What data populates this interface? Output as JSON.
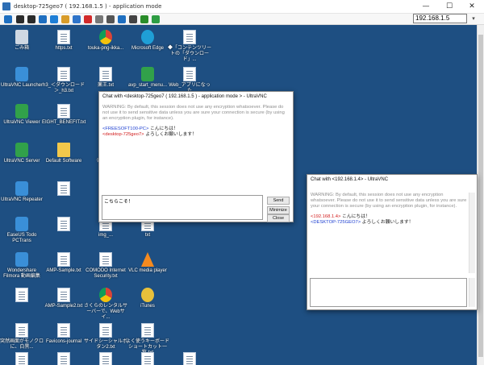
{
  "window": {
    "title": "desktop-725geo7 ( 192.168.1.5 ) - application mode",
    "minimize": "—",
    "maximize": "☐",
    "close": "✕"
  },
  "toolbar": {
    "ip_value": "192.168.1.5",
    "dropdown": "▾",
    "icons": [
      "send-ctrl-alt-del-icon",
      "refresh-icon",
      "settings-icon",
      "copy-icon",
      "windows-key-icon",
      "file-icon",
      "info-icon",
      "stop-icon",
      "chat-icon",
      "fullscreen-icon",
      "rect-icon",
      "close-connection-icon",
      "options-icon",
      "connection-icon"
    ],
    "icon_colors": [
      "#1f6fc0",
      "#2b2b2b",
      "#2b2b2b",
      "#1f6fc0",
      "#1f7fd6",
      "#d89c2a",
      "#2f74c9",
      "#d22a2a",
      "#777777",
      "#555555",
      "#1f6fc0",
      "#444444",
      "#2a8d2a",
      "#2f9e44"
    ]
  },
  "desktop": {
    "icons": [
      {
        "label": "ごみ箱",
        "glyph": "trash",
        "name": "recycle-bin-icon"
      },
      {
        "label": "https.txt",
        "glyph": "file",
        "name": "https-txt-icon"
      },
      {
        "label": "touka-png-ikka...",
        "glyph": "chrome",
        "name": "touka-png-icon"
      },
      {
        "label": "Microsoft Edge",
        "glyph": "edge",
        "name": "edge-icon"
      },
      {
        "label": "◆「コンテンツリートの「ダウンロード」...",
        "glyph": "file",
        "name": "content-download-icon"
      },
      {
        "label": "UltraVNC Launcher",
        "glyph": "app",
        "name": "ultravnc-launcher-icon"
      },
      {
        "label": "h3_＜ダウンロード＞_h3.txt",
        "glyph": "file",
        "name": "h3-download-icon"
      },
      {
        "label": "薬王.txt",
        "glyph": "file",
        "name": "yakuou-txt-icon"
      },
      {
        "label": "avp_start_menu...",
        "glyph": "green",
        "name": "avp-start-menu-icon"
      },
      {
        "label": "Web_アプリになった_Google_Earth.txt",
        "glyph": "file",
        "name": "web-app-google-earth-icon"
      },
      {
        "label": "UltraVNC Viewer",
        "glyph": "green",
        "name": "ultravnc-viewer-icon"
      },
      {
        "label": "EIGHT_BENEFIT.txt",
        "glyph": "file",
        "name": "eight-benefit-icon"
      },
      {
        "label": "myb",
        "glyph": "file",
        "name": "myb-icon"
      },
      {
        "label": "UltraVNC Server",
        "glyph": "green",
        "name": "ultravnc-server-icon"
      },
      {
        "label": "Default Software",
        "glyph": "folder",
        "name": "default-software-icon"
      },
      {
        "label": "チェック",
        "glyph": "round",
        "name": "check-icon"
      },
      {
        "label": "UltraVNC Repeater",
        "glyph": "app",
        "name": "ultravnc-repeater-icon"
      },
      {
        "label": "",
        "glyph": "file",
        "name": "blurred-file-icon"
      },
      {
        "label": "無料",
        "glyph": "file",
        "name": "free-file-icon"
      },
      {
        "label": "EaseUS Todo PCTrans",
        "glyph": "app",
        "name": "easeus-todo-icon"
      },
      {
        "label": "",
        "glyph": "file",
        "name": "blurred-file-2-icon"
      },
      {
        "label": "img_...",
        "glyph": "file",
        "name": "img-file-icon"
      },
      {
        "label": "txt",
        "glyph": "file",
        "name": "txt-file-icon"
      },
      {
        "label": "Wondershare Filmora 動画編集",
        "glyph": "app",
        "name": "filmora-icon"
      },
      {
        "label": "AMP-Sample.txt",
        "glyph": "file",
        "name": "amp-sample-icon"
      },
      {
        "label": "COMODO Internet Security.txt",
        "glyph": "file",
        "name": "comodo-icon"
      },
      {
        "label": "VLC media player",
        "glyph": "vlc",
        "name": "vlc-icon"
      },
      {
        "label": "",
        "glyph": "file",
        "name": "blurred-file-3-icon"
      },
      {
        "label": "AMP-Sample2.txt",
        "glyph": "file",
        "name": "amp-sample2-icon"
      },
      {
        "label": "さくらのレンタルサーバーで、Webサイ...",
        "glyph": "chrome",
        "name": "sakura-server-icon"
      },
      {
        "label": "iTunes",
        "glyph": "round",
        "name": "itunes-icon"
      },
      {
        "label": "突然画面がモノクロに、白黒...",
        "glyph": "file",
        "name": "monochrome-icon"
      },
      {
        "label": "Favicons-journal",
        "glyph": "file",
        "name": "favicons-journal-icon"
      },
      {
        "label": "サイドシーシャルボタン2.txt",
        "glyph": "file",
        "name": "side-social-button-icon"
      },
      {
        "label": "よく使うキーボードショートカット一覧.txt",
        "glyph": "file",
        "name": "keyboard-shortcuts-icon"
      },
      {
        "label": "",
        "glyph": "file",
        "name": "bottom-file-1-icon"
      },
      {
        "label": "",
        "glyph": "file",
        "name": "bottom-file-2-icon"
      },
      {
        "label": "",
        "glyph": "file",
        "name": "bottom-file-3-icon"
      },
      {
        "label": "",
        "glyph": "file",
        "name": "bottom-file-4-icon"
      },
      {
        "label": "",
        "glyph": "file",
        "name": "bottom-file-5-icon"
      }
    ]
  },
  "chat1": {
    "title": "Chat with <desktop-725geo7 ( 192.168.1.5 ) - application mode > - UltraVNC",
    "warning": "WARNING: By default, this session does not use any encryption whatsoever. Please do not use it to send sensitive data unless you are sure your connection is secure (by using an encryption plugin, for instance).",
    "messages": [
      {
        "from": "<FREESOFT100-PC>",
        "text": " こんにちは！",
        "color": "#1d3fd1"
      },
      {
        "from": "<desktop-725geo7>",
        "text": " よろしくお願いします！",
        "color": "#d11919"
      }
    ],
    "input_value": "こちらこそ！",
    "send_label": "Send",
    "minimize_label": "Minimize",
    "close_label": "Close"
  },
  "chat2": {
    "title": "Chat with <192.168.1.4> - UltraVNC",
    "warning": "WARNING: By default, this session does not use any encryption whatsoever. Please do not use it to send sensitive data unless you are sure your connection is secure (by using an encryption plugin, for instance).",
    "messages": [
      {
        "from": "<192.168.1.4>",
        "text": " こんにちは！",
        "color": "#d11919"
      },
      {
        "from": "<DESKTOP-725GEO7>",
        "text": " よろしくお願いします！",
        "color": "#1d3fd1"
      }
    ],
    "input_value": ""
  }
}
